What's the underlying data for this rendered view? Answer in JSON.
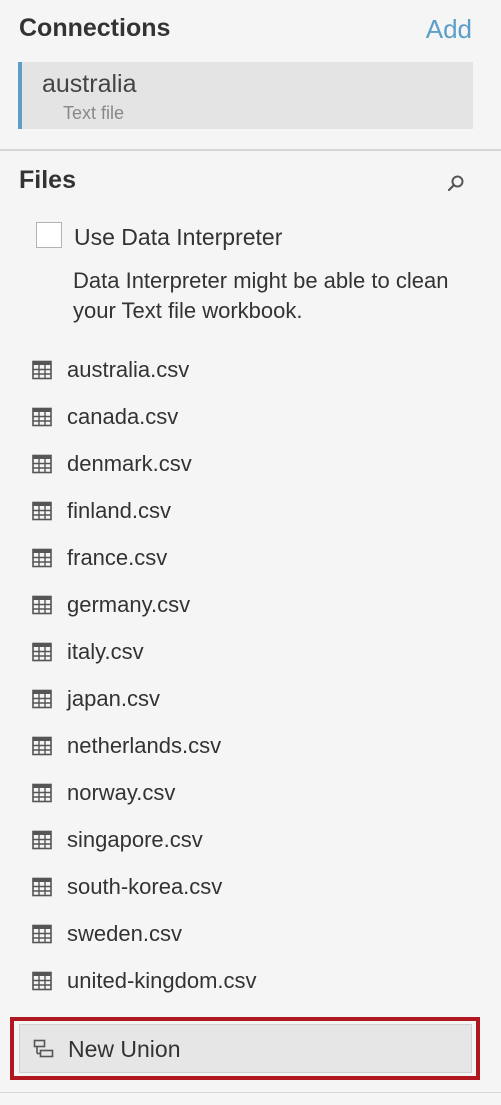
{
  "connections": {
    "title": "Connections",
    "add_label": "Add",
    "items": [
      {
        "name": "australia",
        "type": "Text file"
      }
    ]
  },
  "files": {
    "title": "Files",
    "search_icon": "search-icon",
    "interpreter": {
      "label": "Use Data Interpreter",
      "checked": false,
      "description": "Data Interpreter might be able to clean your Text file workbook."
    },
    "items": [
      {
        "name": "australia.csv",
        "icon": "table-icon"
      },
      {
        "name": "canada.csv",
        "icon": "table-icon"
      },
      {
        "name": "denmark.csv",
        "icon": "table-icon"
      },
      {
        "name": "finland.csv",
        "icon": "table-icon"
      },
      {
        "name": "france.csv",
        "icon": "table-icon"
      },
      {
        "name": "germany.csv",
        "icon": "table-icon"
      },
      {
        "name": "italy.csv",
        "icon": "table-icon"
      },
      {
        "name": "japan.csv",
        "icon": "table-icon"
      },
      {
        "name": "netherlands.csv",
        "icon": "table-icon"
      },
      {
        "name": "norway.csv",
        "icon": "table-icon"
      },
      {
        "name": "singapore.csv",
        "icon": "table-icon"
      },
      {
        "name": "south-korea.csv",
        "icon": "table-icon"
      },
      {
        "name": "sweden.csv",
        "icon": "table-icon"
      },
      {
        "name": "united-kingdom.csv",
        "icon": "table-icon"
      }
    ],
    "new_union": {
      "label": "New Union",
      "icon": "union-icon"
    }
  },
  "colors": {
    "accent": "#5b9fc9",
    "highlight_frame": "#b0171e",
    "panel_bg": "#f5f5f5"
  }
}
